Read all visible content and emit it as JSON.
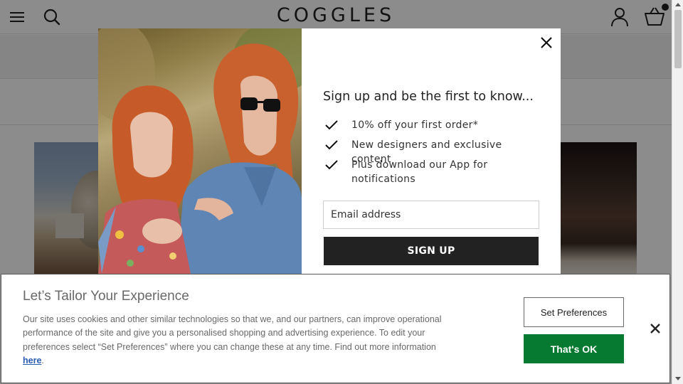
{
  "header": {
    "logo": "COGGLES"
  },
  "modal": {
    "title": "Sign up and be the first to know...",
    "benefits": [
      "10% off your first order*",
      "New designers and exclusive content",
      "Plus download our App for notifications"
    ],
    "email": {
      "placeholder": "Email address",
      "value": ""
    },
    "signup_label": "SIGN UP"
  },
  "cookie_banner": {
    "title": "Let’s Tailor Your Experience",
    "body": "Our site uses cookies and other similar technologies so that we, and our partners, can improve operational performance of the site and give you a personalised shopping and advertising experience. To edit your preferences select “Set Preferences” where you can change these at any time. Find out more information",
    "link_text": "here",
    "set_preferences_label": "Set Preferences",
    "ok_label": "That's OK"
  },
  "icons": {
    "menu": "hamburger-menu-icon",
    "search": "search-icon",
    "account": "account-icon",
    "basket": "basket-icon",
    "close": "close-icon",
    "check": "check-icon"
  },
  "colors": {
    "ok_button": "#067a31",
    "link": "#2a5db0",
    "signup_button": "#222222",
    "overlay": "rgba(0,0,0,0.45)"
  }
}
